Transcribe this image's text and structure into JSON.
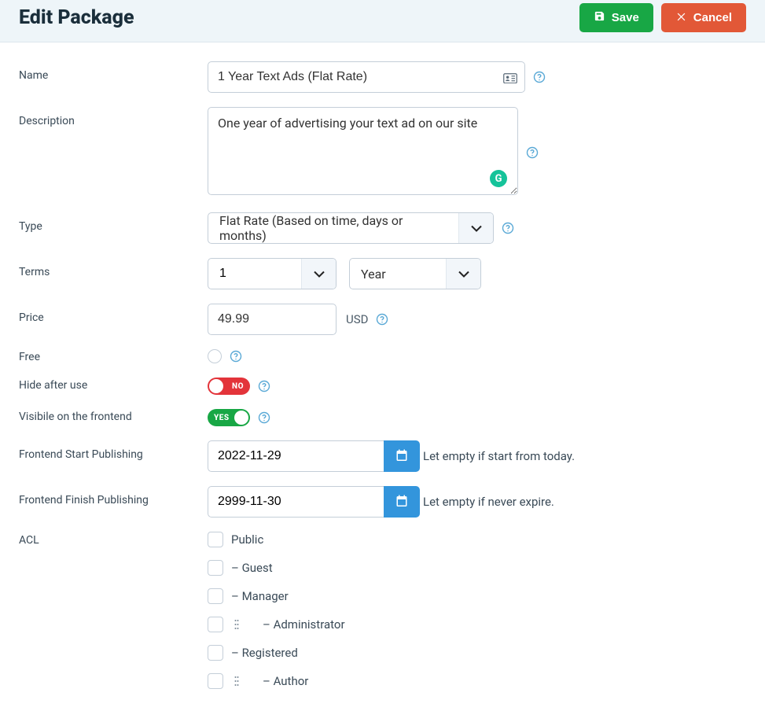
{
  "header": {
    "title": "Edit Package",
    "save": "Save",
    "cancel": "Cancel"
  },
  "labels": {
    "name": "Name",
    "description": "Description",
    "type": "Type",
    "terms": "Terms",
    "price": "Price",
    "free": "Free",
    "hideAfterUse": "Hide after use",
    "visibleFrontend": "Visibile on the frontend",
    "frontendStart": "Frontend Start Publishing",
    "frontendFinish": "Frontend Finish Publishing",
    "acl": "ACL"
  },
  "form": {
    "name": "1 Year Text Ads (Flat Rate)",
    "description": "One year of advertising your text ad on our site",
    "type": "Flat Rate (Based on time, days or months)",
    "termsQty": "1",
    "termsUnit": "Year",
    "price": "49.99",
    "currency": "USD",
    "hideAfterUse": false,
    "visibleFrontend": true,
    "toggleNo": "NO",
    "toggleYes": "YES",
    "frontendStart": "2022-11-29",
    "frontendFinish": "2999-11-30",
    "hintStart": "Let empty if start from today.",
    "hintFinish": "Let empty if never expire."
  },
  "acl": [
    {
      "label": "Public",
      "indent": 0,
      "drag": false
    },
    {
      "label": "– Guest",
      "indent": 0,
      "drag": false
    },
    {
      "label": "– Manager",
      "indent": 0,
      "drag": false
    },
    {
      "label": "– Administrator",
      "indent": 1,
      "drag": true
    },
    {
      "label": "– Registered",
      "indent": 0,
      "drag": false
    },
    {
      "label": "– Author",
      "indent": 1,
      "drag": true
    }
  ]
}
